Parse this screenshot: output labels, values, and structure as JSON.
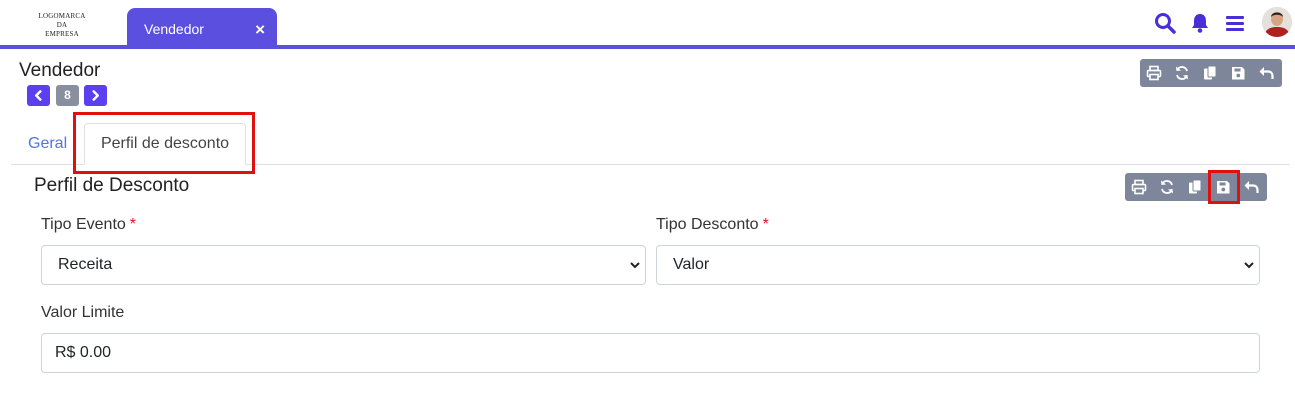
{
  "logo": {
    "line1": "LOGOMARCA",
    "line2": "DA",
    "line3": "EMPRESA"
  },
  "top_tab": {
    "label": "Vendedor",
    "close": "×"
  },
  "top_icons": [
    "search-icon",
    "bell-icon",
    "menu-icon",
    "avatar"
  ],
  "colors": {
    "accent": "#5b4fe0",
    "toolbar": "#7d869b",
    "highlight": "#e01010",
    "link": "#4f74e8"
  },
  "page": {
    "title": "Vendedor",
    "record_nav": {
      "prev": "‹",
      "count": "8",
      "next": "›"
    }
  },
  "toolbar_icons": [
    "print-icon",
    "refresh-icon",
    "copy-icon",
    "save-icon",
    "undo-icon"
  ],
  "tabs": [
    {
      "label": "Geral",
      "active": false
    },
    {
      "label": "Perfil de desconto",
      "active": true
    }
  ],
  "section": {
    "title": "Perfil de Desconto",
    "fields": {
      "tipo_evento": {
        "label": "Tipo Evento",
        "required": "*",
        "value": "Receita"
      },
      "tipo_desconto": {
        "label": "Tipo Desconto",
        "required": "*",
        "value": "Valor"
      },
      "valor_limite": {
        "label": "Valor Limite",
        "value": "R$ 0.00"
      }
    }
  }
}
